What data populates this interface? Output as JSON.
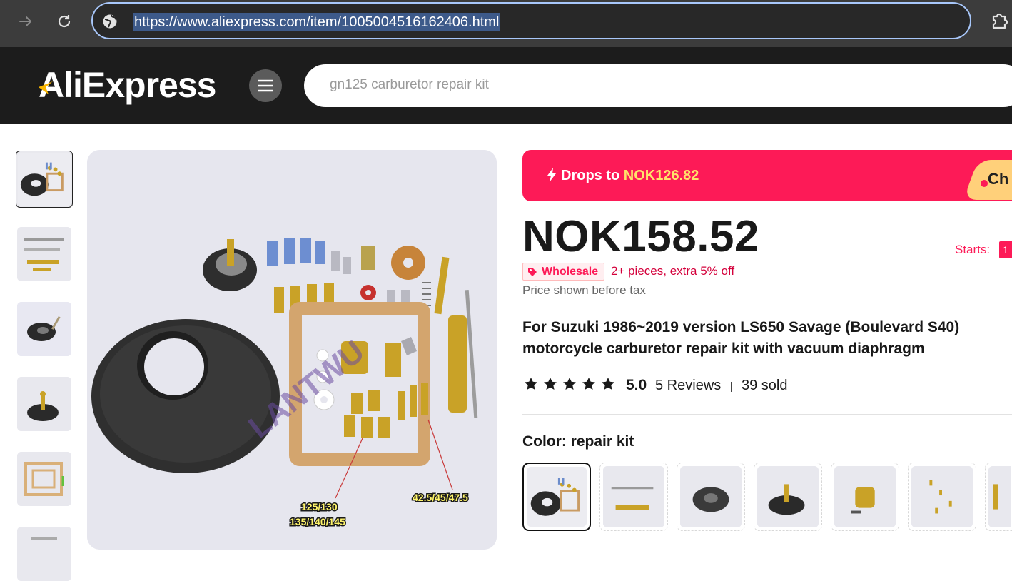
{
  "browser": {
    "url": "https://www.aliexpress.com/item/1005004516162406.html"
  },
  "header": {
    "logo_text": "AliExpress",
    "search_placeholder": "gn125 carburetor repair kit"
  },
  "gallery": {
    "thumbnails": [
      "thumb-1",
      "thumb-2",
      "thumb-3",
      "thumb-4",
      "thumb-5",
      "thumb-6"
    ],
    "main_image": {
      "watermark": "LANTWU",
      "label_left_1": "125/130",
      "label_left_2": "135/140/145",
      "label_right": "42.5/45/47.5"
    }
  },
  "promo": {
    "prefix": "Drops to ",
    "price": "NOK126.82",
    "tag_text": "Ch"
  },
  "product": {
    "price": "NOK158.52",
    "starts_label": "Starts:",
    "starts_value": "1",
    "wholesale_badge": "Wholesale",
    "wholesale_info": "2+ pieces, extra 5% off",
    "tax_note": "Price shown before tax",
    "title": "For Suzuki 1986~2019 version LS650 Savage (Boulevard S40) motorcycle carburetor repair kit with vacuum diaphragm",
    "rating": "5.0",
    "rating_stars": 5,
    "reviews": "5 Reviews",
    "sold": "39 sold",
    "color_label": "Color:",
    "color_value": "repair kit"
  },
  "colors": {
    "accent": "#fd1a57",
    "header_bg": "#1c1c1c",
    "chrome_bg": "#3c3c3c",
    "promo_highlight": "#ffe36a"
  }
}
